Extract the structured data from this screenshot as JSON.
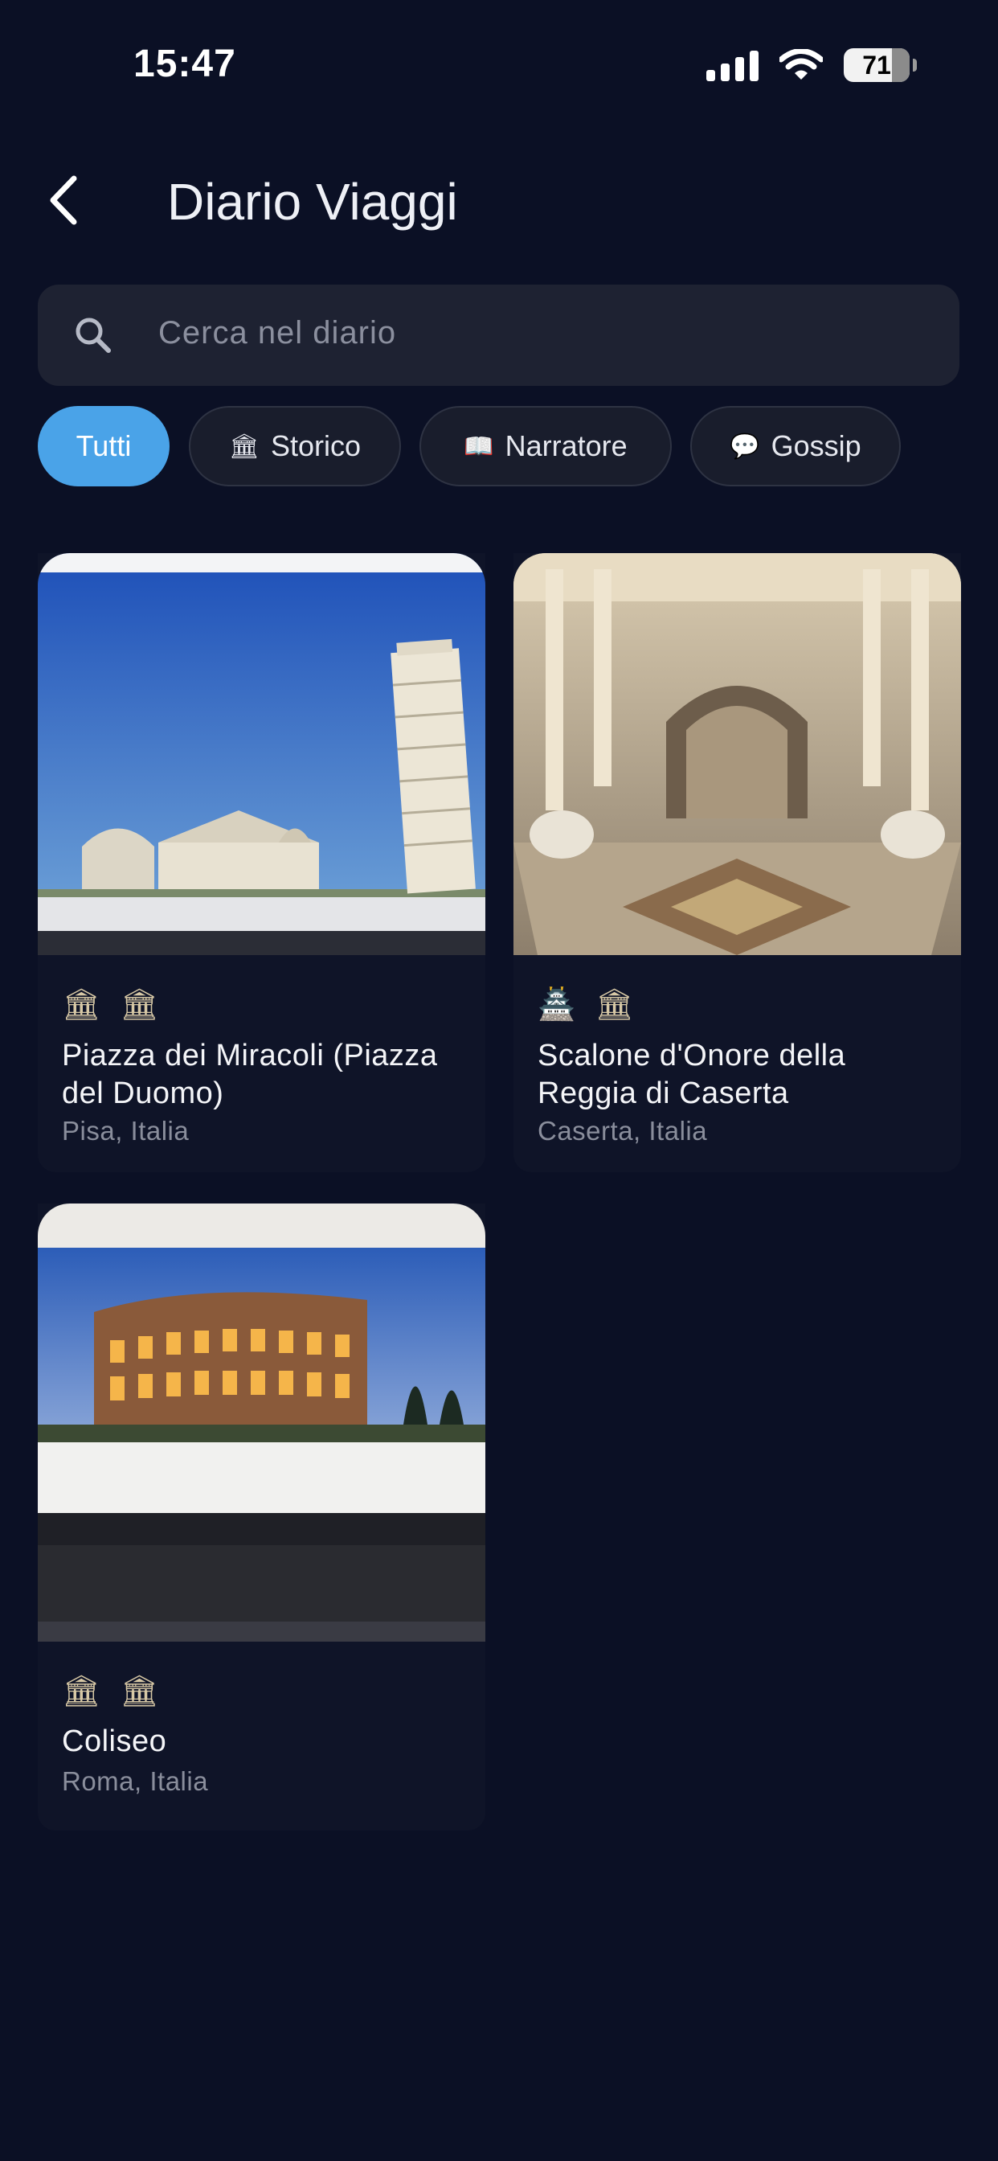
{
  "status": {
    "time": "15:47",
    "battery": "71"
  },
  "header": {
    "title": "Diario Viaggi"
  },
  "search": {
    "placeholder": "Cerca nel diario"
  },
  "filters": [
    {
      "label": "Tutti",
      "icon": "",
      "active": true
    },
    {
      "label": "Storico",
      "icon": "🏛",
      "active": false
    },
    {
      "label": "Narratore",
      "icon": "📖",
      "active": false
    },
    {
      "label": "Gossip",
      "icon": "💬",
      "active": false
    }
  ],
  "cards": [
    {
      "icons": [
        "🏛",
        "🏛"
      ],
      "name": "Piazza dei Miracoli (Piazza del Duomo)",
      "location": "Pisa, Italia",
      "image_icon": "pisa-photo"
    },
    {
      "icons": [
        "🏯",
        "🏛"
      ],
      "name": "Scalone d'Onore della Reggia di Caserta",
      "location": "Caserta, Italia",
      "image_icon": "staircase-photo"
    },
    {
      "icons": [
        "🏛",
        "🏛"
      ],
      "name": "Coliseo",
      "location": "Roma, Italia",
      "image_icon": "colosseum-photo"
    }
  ]
}
